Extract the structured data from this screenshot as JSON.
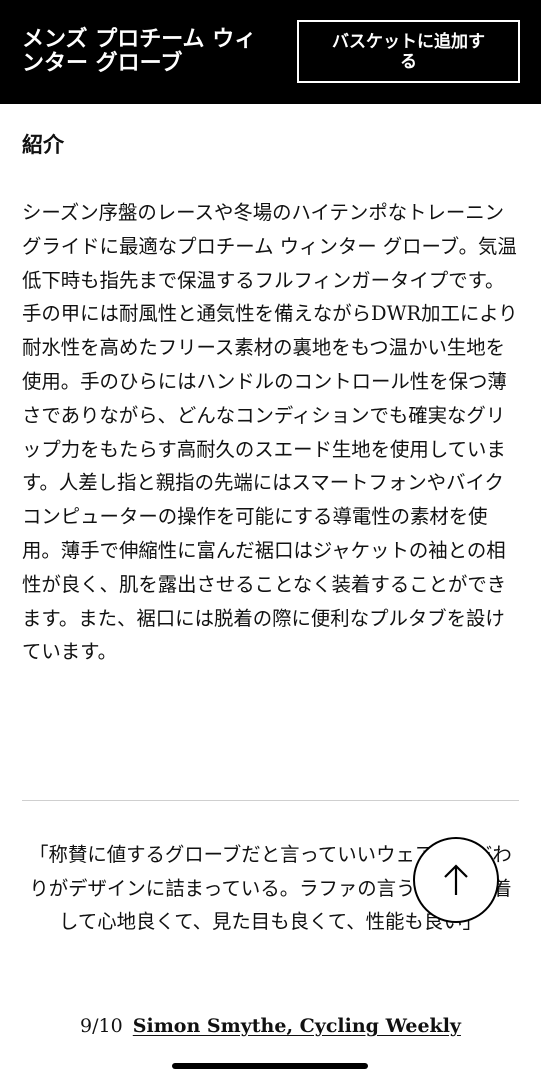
{
  "header": {
    "product_title": "メンズ プロチーム ウィンター グローブ",
    "add_to_basket_label": "バスケットに追加する"
  },
  "description": {
    "heading": "紹介",
    "body": "シーズン序盤のレースや冬場のハイテンポなトレーニングライドに最適なプロチーム ウィンター グローブ。気温低下時も指先まで保温するフルフィンガータイプです。手の甲には耐風性と通気性を備えながらDWR加工により耐水性を高めたフリース素材の裏地をもつ温かい生地を使用。手のひらにはハンドルのコントロール性を保つ薄さでありながら、どんなコンディションでも確実なグリップ力をもたらす高耐久のスエード生地を使用しています。人差し指と親指の先端にはスマートフォンやバイクコンピューターの操作を可能にする導電性の素材を使用。薄手で伸縮性に富んだ裾口はジャケットの袖との相性が良く、肌を露出させることなく装着することができます。また、裾口には脱着の際に便利なプルタブを設けています。"
  },
  "review": {
    "quote": "「称賛に値するグローブだと言っていいウェアのこだわりがデザインに詰まっている。ラファの言う通り、装着して心地良くて、見た目も良くて、性能も良い」",
    "score": "9/10",
    "author": "Simon Smythe, Cycling Weekly"
  },
  "scroll_to_top": {
    "icon": "arrow-up-icon"
  },
  "colors": {
    "header_bg": "#000000",
    "text": "#111111",
    "divider": "#cfcfcf"
  }
}
